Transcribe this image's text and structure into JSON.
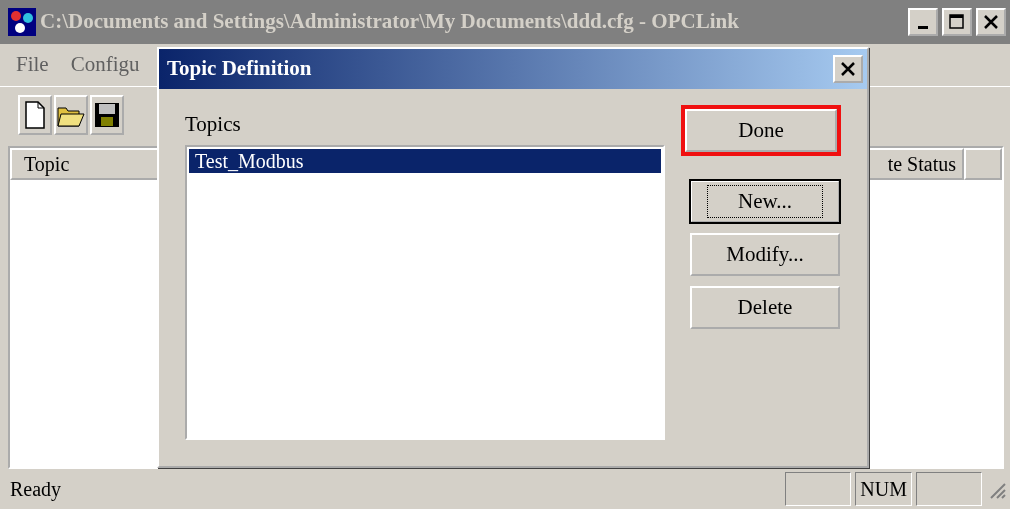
{
  "window": {
    "title": "C:\\Documents and Settings\\Administrator\\My Documents\\ddd.cfg - OPCLink",
    "active": false
  },
  "menu": [
    {
      "label": "File"
    },
    {
      "label": "Configu"
    }
  ],
  "list_header": {
    "columns": [
      {
        "label": "Topic"
      },
      {
        "label": "te Status"
      }
    ]
  },
  "dialog": {
    "title": "Topic Definition",
    "topics_label": "Topics",
    "topics": [
      {
        "label": "Test_Modbus",
        "selected": true
      }
    ],
    "buttons": [
      {
        "label": "Done",
        "highlighted": true,
        "default": false
      },
      {
        "label": "New...",
        "highlighted": false,
        "default": true
      },
      {
        "label": "Modify...",
        "highlighted": false,
        "default": false
      },
      {
        "label": "Delete",
        "highlighted": false,
        "default": false
      }
    ]
  },
  "status_bar": {
    "text": "Ready",
    "indicators": [
      {
        "label": "NUM"
      }
    ]
  }
}
